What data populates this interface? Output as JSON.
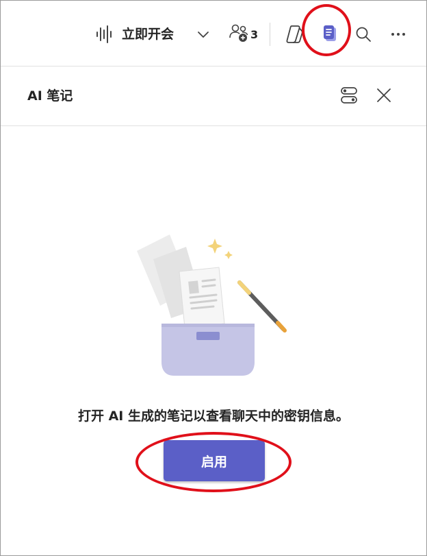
{
  "toolbar": {
    "meet_now_label": "立即开会",
    "participants_count": "3",
    "icons": [
      "audio-wave-icon",
      "chevron-down-icon",
      "people-add-icon",
      "copilot-icon",
      "notes-icon",
      "search-icon",
      "more-icon"
    ]
  },
  "panel": {
    "title": "AI 笔记",
    "message": "打开 AI 生成的笔记以查看聊天中的密钥信息。",
    "enable_button": "启用"
  },
  "colors": {
    "accent": "#5b5fc7",
    "highlight_ring": "#e0101a",
    "text": "#242424"
  }
}
